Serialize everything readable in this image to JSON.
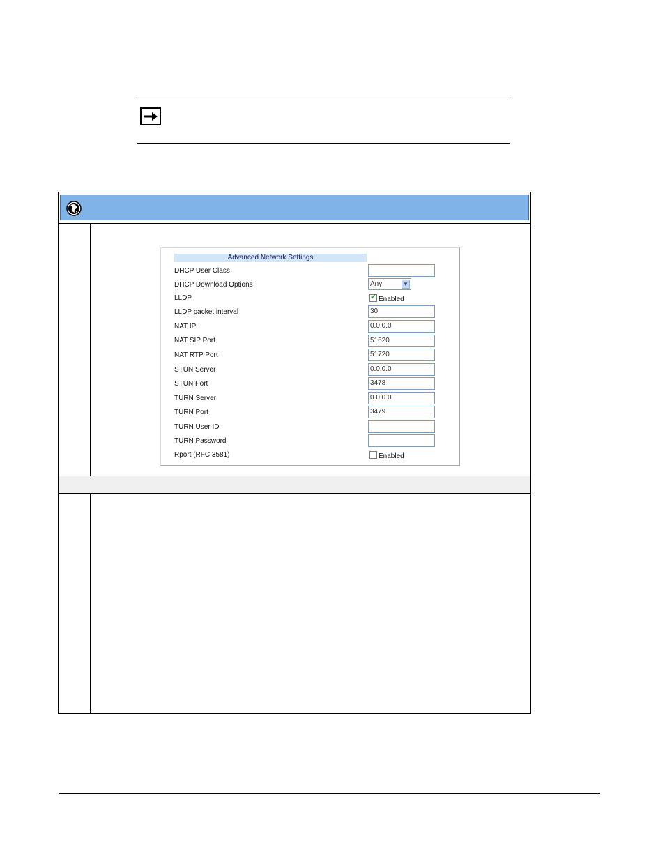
{
  "note": {
    "icon": "arrow-right-icon"
  },
  "procedure": {
    "header_icon": "globe-icon",
    "header_color": "#80b3e8"
  },
  "advanced_network_settings": {
    "title": "Advanced Network Settings",
    "fields": [
      {
        "label": "DHCP User Class",
        "type": "text",
        "value": ""
      },
      {
        "label": "DHCP Download Options",
        "type": "select",
        "value": "Any"
      },
      {
        "label": "LLDP",
        "type": "checkbox",
        "checked": true,
        "check_label": "Enabled"
      },
      {
        "label": "LLDP packet interval",
        "type": "text",
        "value": "30"
      },
      {
        "label": "NAT IP",
        "type": "text",
        "value": "0.0.0.0"
      },
      {
        "label": "NAT SIP Port",
        "type": "text",
        "value": "51620"
      },
      {
        "label": "NAT RTP Port",
        "type": "text",
        "value": "51720"
      },
      {
        "label": "STUN Server",
        "type": "text",
        "value": "0.0.0.0"
      },
      {
        "label": "STUN Port",
        "type": "text",
        "value": "3478"
      },
      {
        "label": "TURN Server",
        "type": "text",
        "value": "0.0.0.0"
      },
      {
        "label": "TURN Port",
        "type": "text",
        "value": "3479"
      },
      {
        "label": "TURN User ID",
        "type": "text",
        "value": ""
      },
      {
        "label": "TURN Password",
        "type": "text",
        "value": ""
      },
      {
        "label": "Rport (RFC 3581)",
        "type": "checkbox",
        "checked": false,
        "check_label": "Enabled"
      }
    ]
  }
}
